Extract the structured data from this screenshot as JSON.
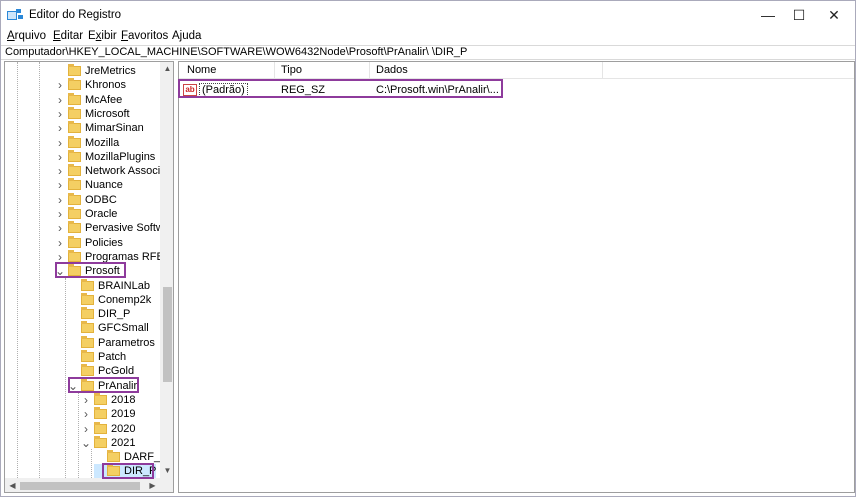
{
  "window": {
    "title": "Editor do Registro",
    "controls": {
      "minimize": "—",
      "maximize": "☐",
      "close": "✕"
    }
  },
  "menu": [
    "Arquivo",
    "Editar",
    "Exibir",
    "Favoritos",
    "Ajuda"
  ],
  "menu_underline": [
    "A",
    "E",
    "x",
    "F",
    "j"
  ],
  "address": "Computador\\HKEY_LOCAL_MACHINE\\SOFTWARE\\WOW6432Node\\Prosoft\\PrAnalir\\   \\DIR_P",
  "tree": {
    "items": [
      {
        "label": "JreMetrics",
        "level": 0,
        "state": "none"
      },
      {
        "label": "Khronos",
        "level": 0,
        "state": "collapsed"
      },
      {
        "label": "McAfee",
        "level": 0,
        "state": "collapsed"
      },
      {
        "label": "Microsoft",
        "level": 0,
        "state": "collapsed"
      },
      {
        "label": "MimarSinan",
        "level": 0,
        "state": "collapsed"
      },
      {
        "label": "Mozilla",
        "level": 0,
        "state": "collapsed"
      },
      {
        "label": "MozillaPlugins",
        "level": 0,
        "state": "collapsed"
      },
      {
        "label": "Network Associat",
        "level": 0,
        "state": "collapsed"
      },
      {
        "label": "Nuance",
        "level": 0,
        "state": "collapsed"
      },
      {
        "label": "ODBC",
        "level": 0,
        "state": "collapsed"
      },
      {
        "label": "Oracle",
        "level": 0,
        "state": "collapsed"
      },
      {
        "label": "Pervasive Softwar",
        "level": 0,
        "state": "collapsed"
      },
      {
        "label": "Policies",
        "level": 0,
        "state": "collapsed"
      },
      {
        "label": "Programas RFB",
        "level": 0,
        "state": "collapsed"
      },
      {
        "label": "Prosoft",
        "level": 0,
        "state": "expanded"
      },
      {
        "label": "BRAINLab",
        "level": 1,
        "state": "none"
      },
      {
        "label": "Conemp2k",
        "level": 1,
        "state": "none"
      },
      {
        "label": "DIR_P",
        "level": 1,
        "state": "none"
      },
      {
        "label": "GFCSmall",
        "level": 1,
        "state": "none"
      },
      {
        "label": "Parametros",
        "level": 1,
        "state": "none"
      },
      {
        "label": "Patch",
        "level": 1,
        "state": "none"
      },
      {
        "label": "PcGold",
        "level": 1,
        "state": "none"
      },
      {
        "label": "PrAnalir",
        "level": 1,
        "state": "expanded"
      },
      {
        "label": "2018",
        "level": 2,
        "state": "collapsed"
      },
      {
        "label": "2019",
        "level": 2,
        "state": "collapsed"
      },
      {
        "label": "2020",
        "level": 2,
        "state": "collapsed"
      },
      {
        "label": "2021",
        "level": 2,
        "state": "expanded"
      },
      {
        "label": "DARF_C",
        "level": 3,
        "state": "none"
      },
      {
        "label": "DIR_P",
        "level": 3,
        "state": "none",
        "selected": true
      }
    ]
  },
  "list": {
    "columns": [
      "Nome",
      "Tipo",
      "Dados"
    ],
    "rows": [
      {
        "icon": "string-value-icon",
        "icon_text": "ab",
        "name": "(Padrão)",
        "type": "REG_SZ",
        "data": "C:\\Prosoft.win\\PrAnalir\\..."
      }
    ]
  },
  "colors": {
    "highlight": "#8e3b9c",
    "folder": "#f4cf63"
  }
}
